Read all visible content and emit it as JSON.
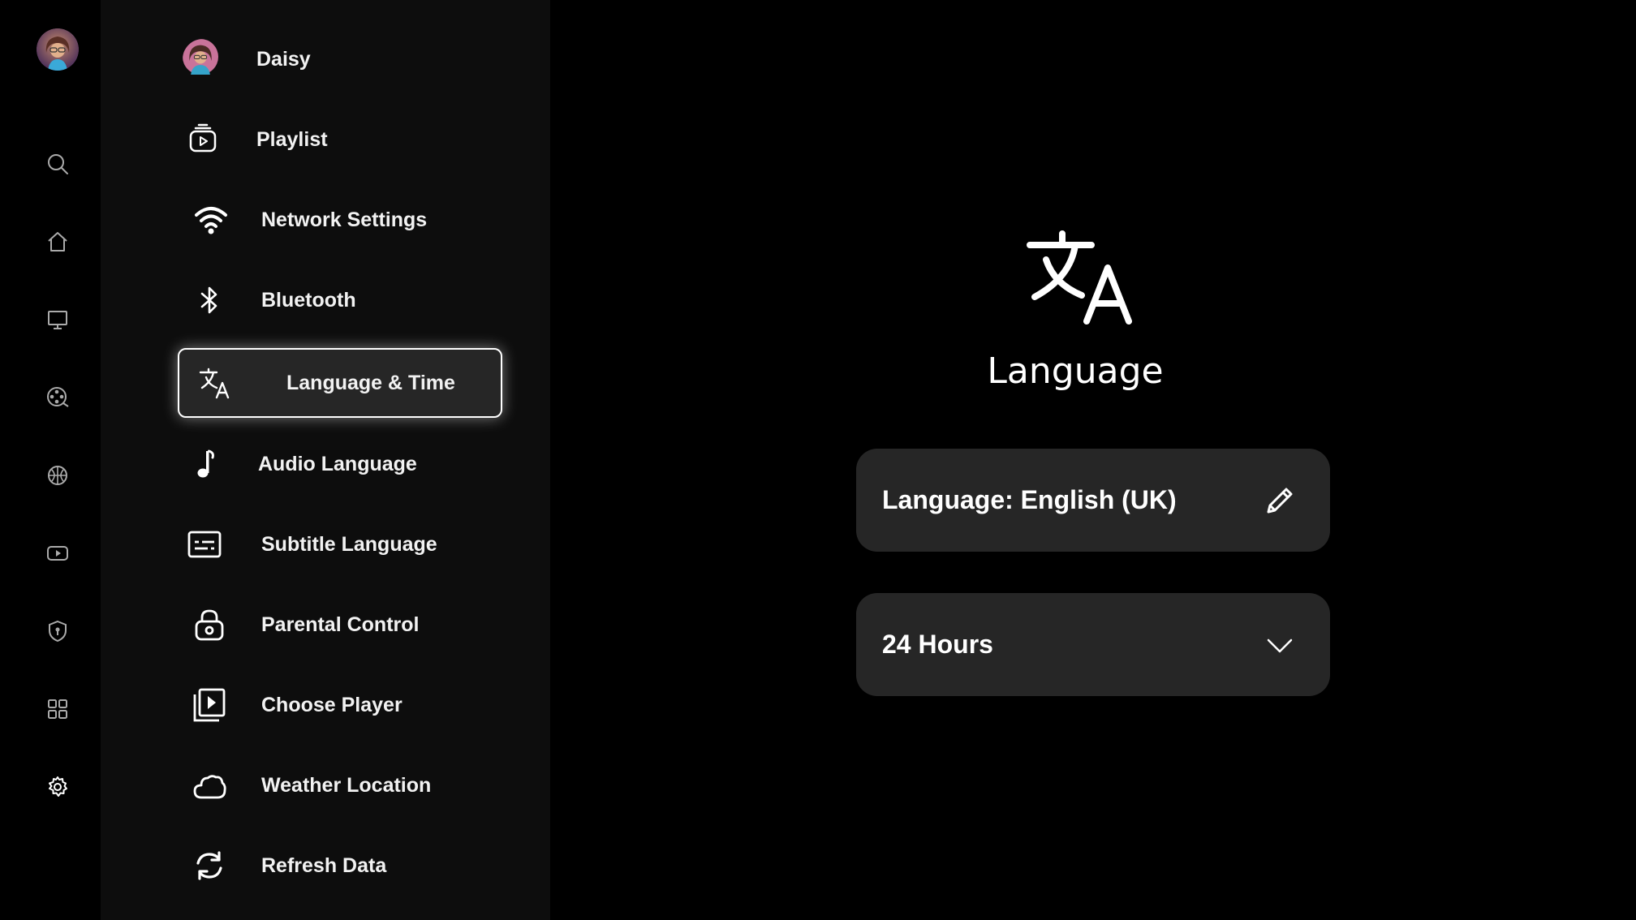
{
  "rail": {
    "items": [
      {
        "name": "search-icon"
      },
      {
        "name": "home-icon"
      },
      {
        "name": "tv-icon"
      },
      {
        "name": "film-reel-icon"
      },
      {
        "name": "sports-ball-icon"
      },
      {
        "name": "youtube-icon"
      },
      {
        "name": "shield-icon"
      },
      {
        "name": "apps-grid-icon"
      },
      {
        "name": "gear-icon"
      }
    ]
  },
  "menu": {
    "items": [
      {
        "label": "Daisy",
        "icon": "avatar"
      },
      {
        "label": "Playlist",
        "icon": "playlist-icon"
      },
      {
        "label": "Network Settings",
        "icon": "wifi-icon"
      },
      {
        "label": "Bluetooth",
        "icon": "bluetooth-icon"
      },
      {
        "label": "Language & Time",
        "icon": "translate-icon",
        "active": true
      },
      {
        "label": "Audio Language",
        "icon": "music-note-icon"
      },
      {
        "label": "Subtitle Language",
        "icon": "subtitles-icon"
      },
      {
        "label": "Parental Control",
        "icon": "lock-icon"
      },
      {
        "label": "Choose Player",
        "icon": "video-library-icon"
      },
      {
        "label": "Weather Location",
        "icon": "cloud-icon"
      },
      {
        "label": "Refresh Data",
        "icon": "refresh-icon"
      }
    ]
  },
  "content": {
    "title": "Language",
    "language_label": "Language: English (UK)",
    "time_format": "24 Hours"
  }
}
